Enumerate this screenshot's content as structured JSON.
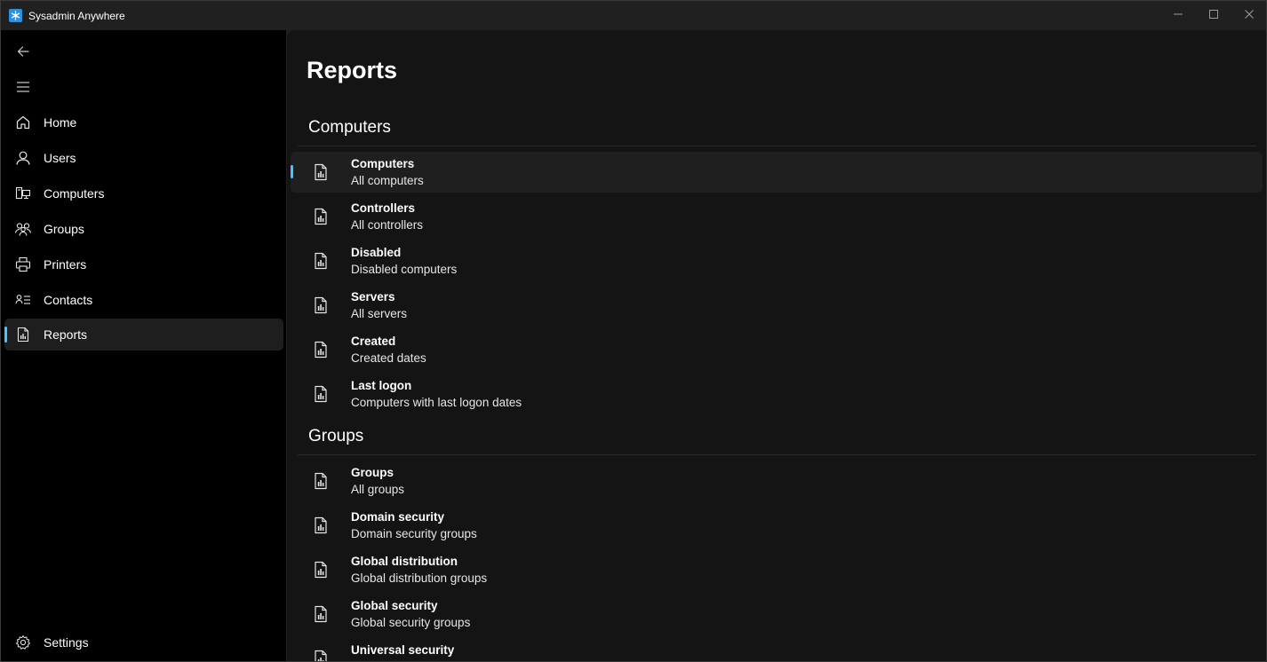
{
  "app": {
    "title": "Sysadmin Anywhere",
    "accent_color": "#4cc2ff"
  },
  "window_controls": {
    "minimize_icon": "minimize-icon",
    "maximize_icon": "maximize-icon",
    "close_icon": "close-icon"
  },
  "sidebar": {
    "back_icon": "back-arrow-icon",
    "menu_icon": "hamburger-menu-icon",
    "items": [
      {
        "label": "Home",
        "icon": "home-icon",
        "selected": false
      },
      {
        "label": "Users",
        "icon": "user-icon",
        "selected": false
      },
      {
        "label": "Computers",
        "icon": "computer-icon",
        "selected": false
      },
      {
        "label": "Groups",
        "icon": "people-icon",
        "selected": false
      },
      {
        "label": "Printers",
        "icon": "printer-icon",
        "selected": false
      },
      {
        "label": "Contacts",
        "icon": "contact-card-icon",
        "selected": false
      },
      {
        "label": "Reports",
        "icon": "report-icon",
        "selected": true
      }
    ],
    "settings": {
      "label": "Settings",
      "icon": "gear-icon"
    }
  },
  "main": {
    "title": "Reports",
    "sections": [
      {
        "title": "Computers",
        "items": [
          {
            "title": "Computers",
            "subtitle": "All computers",
            "selected": true
          },
          {
            "title": "Controllers",
            "subtitle": "All controllers",
            "selected": false
          },
          {
            "title": "Disabled",
            "subtitle": "Disabled computers",
            "selected": false
          },
          {
            "title": "Servers",
            "subtitle": "All servers",
            "selected": false
          },
          {
            "title": "Created",
            "subtitle": "Created dates",
            "selected": false
          },
          {
            "title": "Last logon",
            "subtitle": "Computers with last logon dates",
            "selected": false
          }
        ]
      },
      {
        "title": "Groups",
        "items": [
          {
            "title": "Groups",
            "subtitle": "All groups",
            "selected": false
          },
          {
            "title": "Domain security",
            "subtitle": "Domain security groups",
            "selected": false
          },
          {
            "title": "Global distribution",
            "subtitle": "Global distribution groups",
            "selected": false
          },
          {
            "title": "Global security",
            "subtitle": "Global security groups",
            "selected": false
          },
          {
            "title": "Universal security",
            "subtitle": "",
            "selected": false
          }
        ]
      }
    ]
  }
}
